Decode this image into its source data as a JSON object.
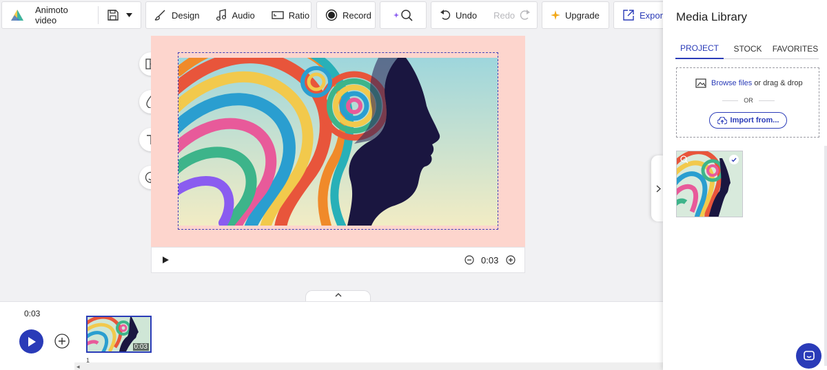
{
  "toolbar": {
    "project_name": "Animoto video",
    "design_label": "Design",
    "audio_label": "Audio",
    "ratio_label": "Ratio",
    "record_label": "Record",
    "undo_label": "Undo",
    "redo_label": "Redo",
    "upgrade_label": "Upgrade",
    "export_label": "Export"
  },
  "player": {
    "duration": "0:03"
  },
  "timeline": {
    "total_time": "0:03",
    "clip_duration": "0:03",
    "clip_number": "1"
  },
  "media_library": {
    "title": "Media Library",
    "tabs": [
      "PROJECT",
      "STOCK",
      "FAVORITES"
    ],
    "active_tab": "PROJECT",
    "browse_link": "Browse files",
    "browse_suffix": " or drag & drop",
    "or_text": "OR",
    "import_label": "Import from..."
  },
  "colors": {
    "accent": "#2a3bb8",
    "stage_bg": "#fdd5cd",
    "selection": "#3f3fb8"
  },
  "icons": [
    "logo-icon",
    "save-icon",
    "caret-down-icon",
    "design-brush-icon",
    "audio-note-icon",
    "ratio-icon",
    "record-icon",
    "magic-search-icon",
    "undo-icon",
    "redo-icon",
    "sparkle-icon",
    "export-icon",
    "layout-icon",
    "droplet-icon",
    "text-icon",
    "sticker-icon",
    "play-icon",
    "zoom-out-icon",
    "zoom-in-icon",
    "chevron-up-icon",
    "add-icon",
    "image-icon",
    "cloud-upload-icon",
    "chevron-right-icon",
    "chat-icon",
    "check-icon"
  ]
}
